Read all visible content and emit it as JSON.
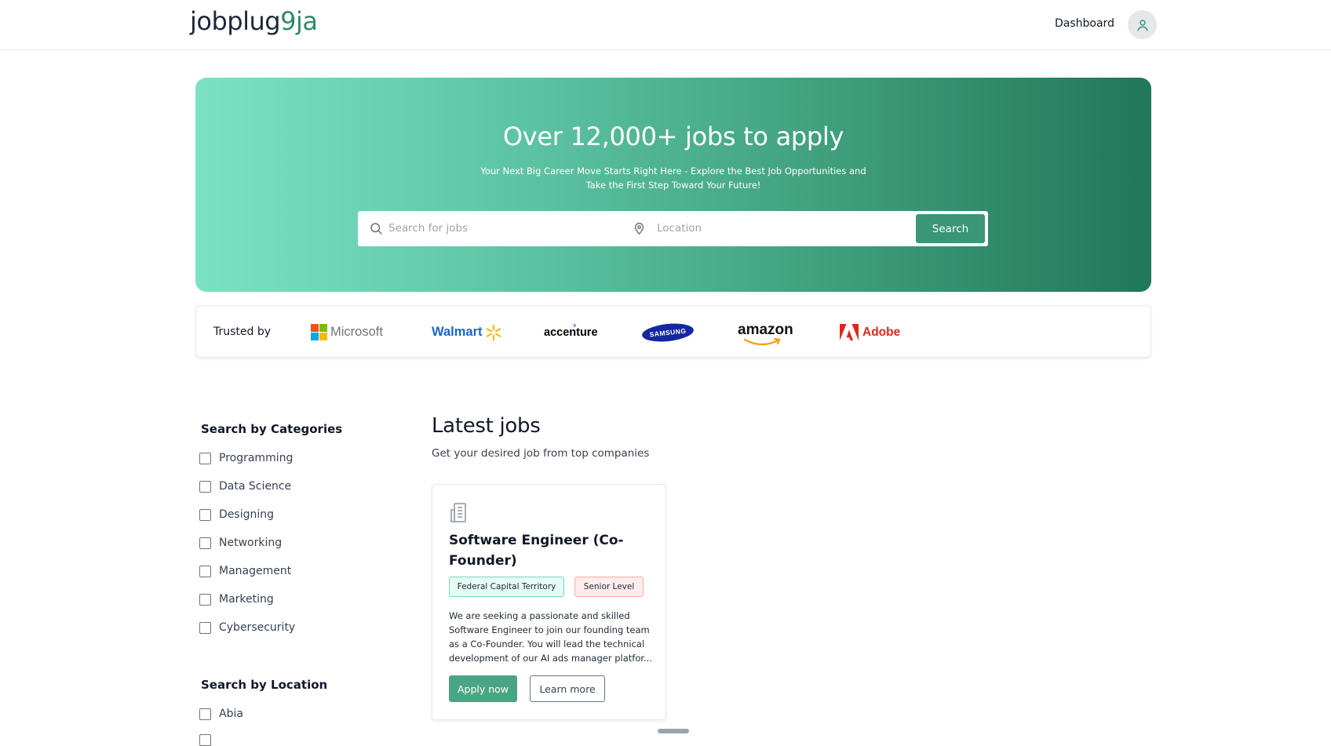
{
  "header": {
    "logo_part1": "jobplug",
    "logo_part2": "9ja",
    "dashboard_label": "Dashboard",
    "avatar_icon": "user-icon"
  },
  "hero": {
    "title": "Over 12,000+ jobs to apply",
    "subtitle": "Your Next Big Career Move Starts Right Here - Explore the Best Job Opportunities and Take the First Step Toward Your Future!",
    "search_placeholder": "Search for jobs",
    "location_placeholder": "Location",
    "search_button": "Search",
    "colors": {
      "gradient_start": "#7be2c4",
      "gradient_end": "#217759"
    }
  },
  "trusted": {
    "label": "Trusted by",
    "brands": [
      {
        "name": "Microsoft",
        "color": "#737373"
      },
      {
        "name": "Walmart",
        "color": "#1a66c9",
        "spark_color": "#fbbf24"
      },
      {
        "name": "accenture",
        "color": "#000000",
        "accent": "#a100ff"
      },
      {
        "name": "SAMSUNG",
        "color": "#ffffff",
        "bg": "#1428a0"
      },
      {
        "name": "amazon",
        "color": "#111111",
        "smile": "#f59e0b"
      },
      {
        "name": "Adobe",
        "color": "#e1251b"
      }
    ]
  },
  "sidebar": {
    "categories_heading": "Search by Categories",
    "categories": [
      "Programming",
      "Data Science",
      "Designing",
      "Networking",
      "Management",
      "Marketing",
      "Cybersecurity"
    ],
    "location_heading": "Search by Location",
    "locations": [
      "Abia"
    ]
  },
  "main": {
    "title": "Latest jobs",
    "subtitle": "Get your desired job from top companies",
    "jobs": [
      {
        "icon": "building-icon",
        "title": "Software Engineer (Co-Founder)",
        "location": "Federal Capital Territory",
        "level": "Senior Level",
        "description": "We are seeking a passionate and skilled Software Engineer to join our founding team as a Co-Founder. You will lead the technical development of our AI ads manager platfor...",
        "apply_label": "Apply now",
        "learn_label": "Learn more"
      }
    ]
  },
  "colors": {
    "accent": "#3a9676"
  }
}
